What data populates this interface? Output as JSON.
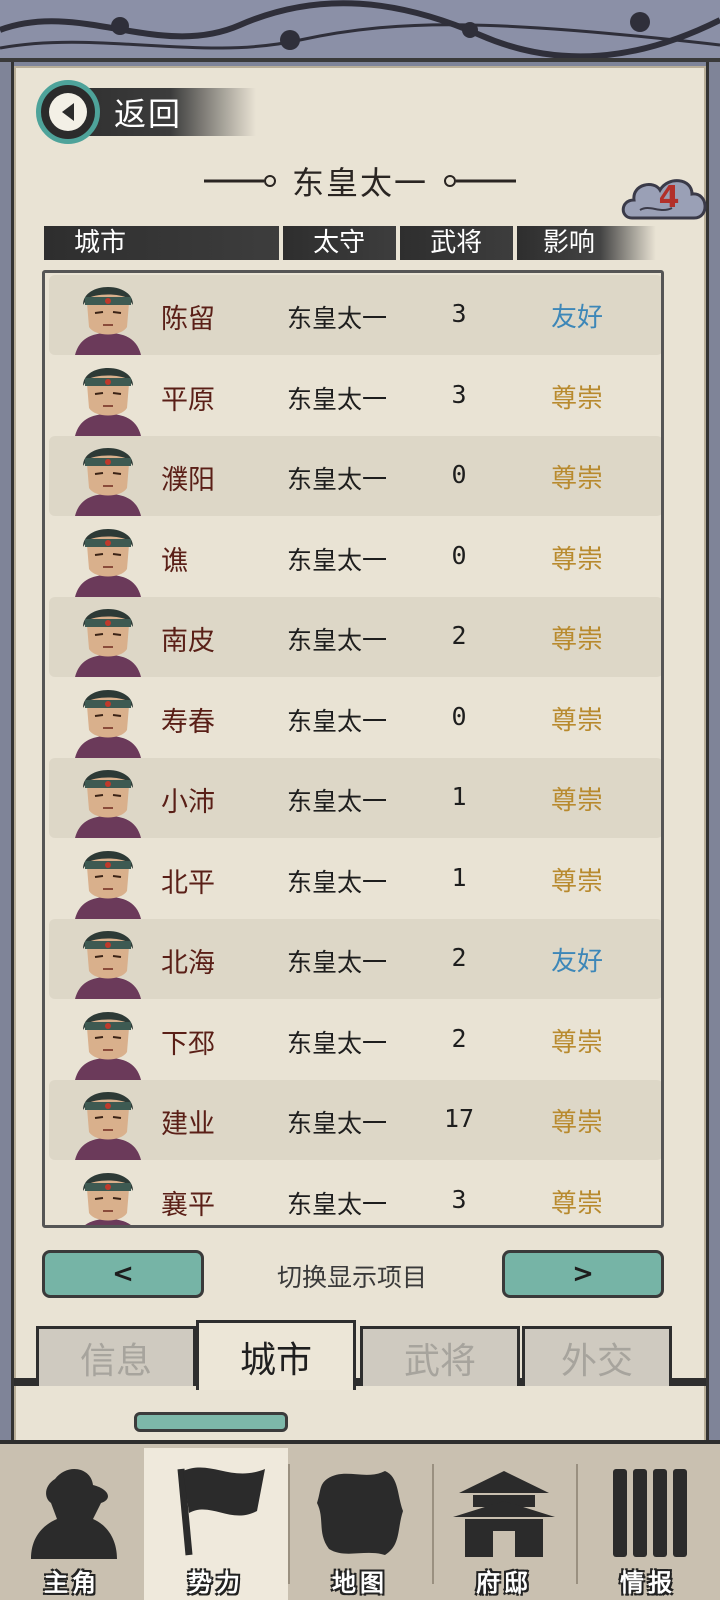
{
  "header": {
    "back_label": "返回",
    "faction_name": "东皇太一",
    "badge_count": "4"
  },
  "table": {
    "columns": {
      "city": "城市",
      "governor": "太守",
      "generals": "武将",
      "influence": "影响"
    },
    "rows": [
      {
        "city": "陈留",
        "governor": "东皇太一",
        "generals": "3",
        "influence": "友好",
        "tone": "friendly"
      },
      {
        "city": "平原",
        "governor": "东皇太一",
        "generals": "3",
        "influence": "尊崇",
        "tone": "revered"
      },
      {
        "city": "濮阳",
        "governor": "东皇太一",
        "generals": "0",
        "influence": "尊崇",
        "tone": "revered"
      },
      {
        "city": "谯",
        "governor": "东皇太一",
        "generals": "0",
        "influence": "尊崇",
        "tone": "revered"
      },
      {
        "city": "南皮",
        "governor": "东皇太一",
        "generals": "2",
        "influence": "尊崇",
        "tone": "revered"
      },
      {
        "city": "寿春",
        "governor": "东皇太一",
        "generals": "0",
        "influence": "尊崇",
        "tone": "revered"
      },
      {
        "city": "小沛",
        "governor": "东皇太一",
        "generals": "1",
        "influence": "尊崇",
        "tone": "revered"
      },
      {
        "city": "北平",
        "governor": "东皇太一",
        "generals": "1",
        "influence": "尊崇",
        "tone": "revered"
      },
      {
        "city": "北海",
        "governor": "东皇太一",
        "generals": "2",
        "influence": "友好",
        "tone": "friendly"
      },
      {
        "city": "下邳",
        "governor": "东皇太一",
        "generals": "2",
        "influence": "尊崇",
        "tone": "revered"
      },
      {
        "city": "建业",
        "governor": "东皇太一",
        "generals": "17",
        "influence": "尊崇",
        "tone": "revered"
      },
      {
        "city": "襄平",
        "governor": "东皇太一",
        "generals": "3",
        "influence": "尊崇",
        "tone": "revered"
      }
    ]
  },
  "pager": {
    "prev": "<",
    "next": ">",
    "label": "切换显示项目"
  },
  "tabs": [
    {
      "label": "信息",
      "active": false
    },
    {
      "label": "城市",
      "active": true
    },
    {
      "label": "武将",
      "active": false
    },
    {
      "label": "外交",
      "active": false
    }
  ],
  "bottom_nav": [
    {
      "label": "主角",
      "icon": "hero-icon",
      "active": false
    },
    {
      "label": "势力",
      "icon": "flag-icon",
      "active": true
    },
    {
      "label": "地图",
      "icon": "map-icon",
      "active": false
    },
    {
      "label": "府邸",
      "icon": "mansion-icon",
      "active": false
    },
    {
      "label": "情报",
      "icon": "scroll-icon",
      "active": false
    }
  ],
  "colors": {
    "friendly": "#3d87b8",
    "revered": "#b88a2e",
    "accent": "#76b4a6"
  }
}
